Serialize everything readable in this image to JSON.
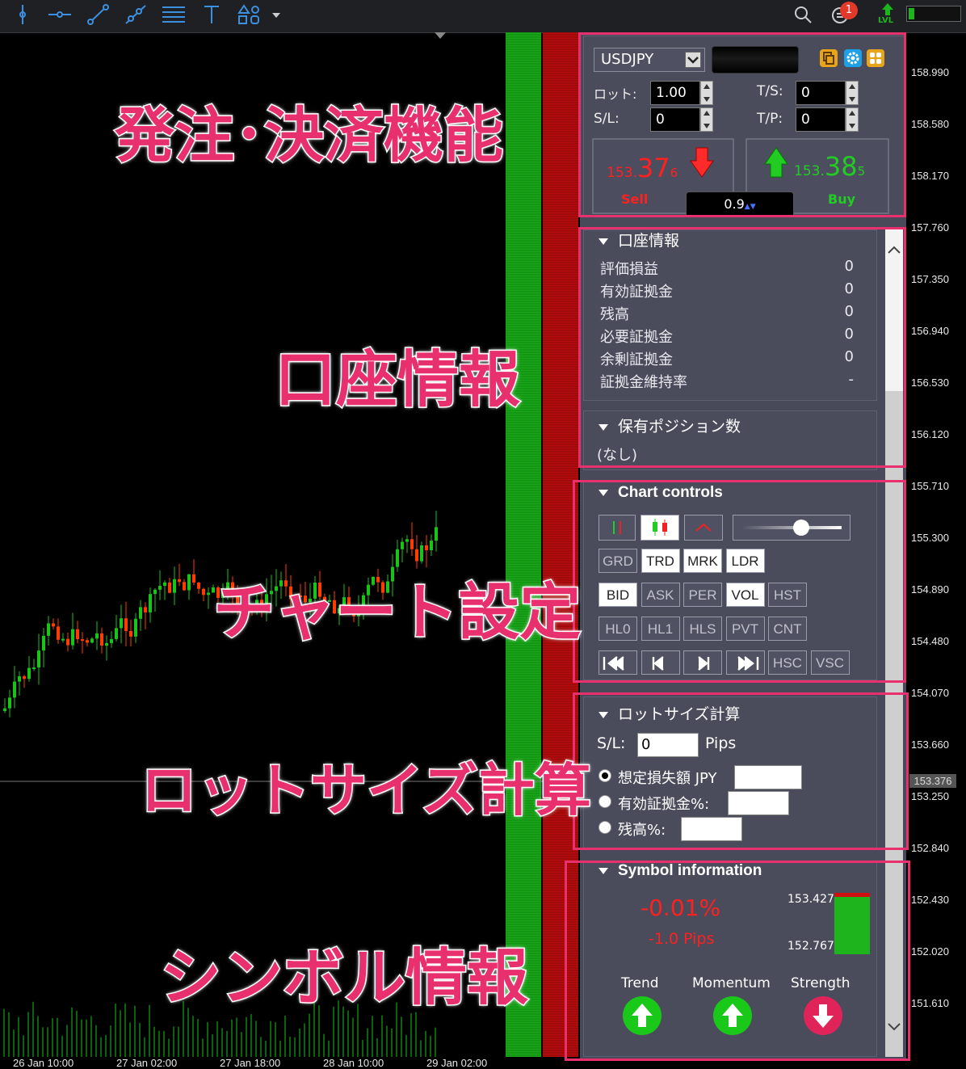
{
  "toolbar": {
    "tools": [
      "vertical-line-icon",
      "horizontal-line-icon",
      "trend-line-icon",
      "ray-icon",
      "fibonacci-icon",
      "text-tool-icon",
      "shapes-icon"
    ],
    "notification_count": "1",
    "lvl_label": "LVL",
    "lvl_level": 0.12
  },
  "chart": {
    "price_ticks": [
      "158.990",
      "158.580",
      "158.170",
      "157.760",
      "157.350",
      "156.940",
      "156.530",
      "156.120",
      "155.710",
      "155.300",
      "154.890",
      "154.480",
      "154.070",
      "153.660",
      "153.250",
      "152.840",
      "152.430",
      "152.020",
      "151.610"
    ],
    "current_price": "153.376",
    "time_ticks": [
      "26 Jan 10:00",
      "27 Jan 02:00",
      "27 Jan 18:00",
      "28 Jan 10:00",
      "29 Jan 02:00"
    ],
    "colors": {
      "bull": "#19c419",
      "bear": "#ff3c00",
      "panel_green": "#1aa61a",
      "panel_red": "#b50d0d"
    }
  },
  "order": {
    "symbol": "USDJPY",
    "lot_label": "ロット:",
    "lot_value": "1.00",
    "ts_label": "T/S:",
    "ts_value": "0",
    "sl_label": "S/L:",
    "sl_value": "0",
    "tp_label": "T/P:",
    "tp_value": "0",
    "sell_price_small": "153.",
    "sell_price_big": "37",
    "sell_price_pip": "6",
    "buy_price_small": "153.",
    "buy_price_big": "38",
    "buy_price_pip": "5",
    "sell_label": "Sell",
    "buy_label": "Buy",
    "spread": "0.9"
  },
  "account": {
    "title": "口座情報",
    "rows": [
      {
        "label": "評価損益",
        "value": "0"
      },
      {
        "label": "有効証拠金",
        "value": "0"
      },
      {
        "label": "残高",
        "value": "0"
      },
      {
        "label": "必要証拠金",
        "value": "0"
      },
      {
        "label": "余剰証拠金",
        "value": "0"
      },
      {
        "label": "証拠金維持率",
        "value": "-"
      }
    ]
  },
  "positions": {
    "title": "保有ポジション数",
    "empty": "(なし)"
  },
  "chart_controls": {
    "title": "Chart controls",
    "row2": [
      "GRD",
      "TRD",
      "MRK",
      "LDR"
    ],
    "row3": [
      "BID",
      "ASK",
      "PER",
      "VOL",
      "HST"
    ],
    "row4": [
      "HL0",
      "HL1",
      "HLS",
      "PVT",
      "CNT"
    ],
    "row5_text": [
      "HSC",
      "VSC"
    ],
    "slider_level": 0.6
  },
  "lot_calc": {
    "title": "ロットサイズ計算",
    "sl_label": "S/L:",
    "sl_value": "0",
    "pips_label": "Pips",
    "option1": "想定損失額 JPY",
    "option2": "有効証拠金%:",
    "option3": "残高%:"
  },
  "symbol_info": {
    "title": "Symbol information",
    "change_pct": "-0.01%",
    "change_pips": "-1.0 Pips",
    "high": "153.427",
    "low": "152.767",
    "trend_label": "Trend",
    "momentum_label": "Momentum",
    "strength_label": "Strength"
  },
  "annotations": {
    "order": "発注･決済機能",
    "account": "口座情報",
    "chart_settings": "チャート設定",
    "lot_calc": "ロットサイズ計算",
    "symbol": "シンボル情報"
  }
}
